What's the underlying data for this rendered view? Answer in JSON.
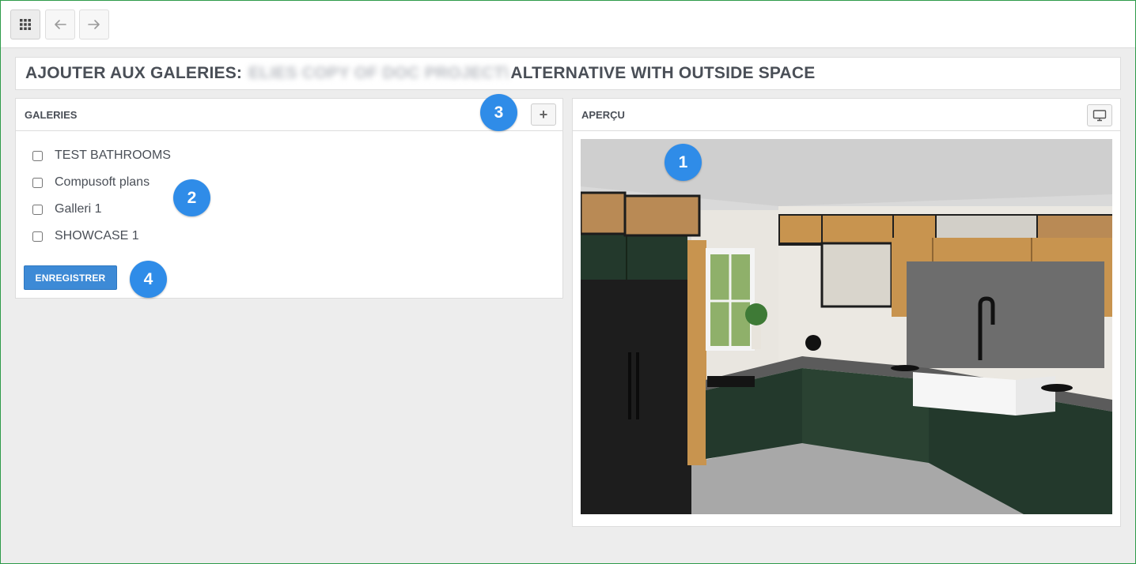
{
  "page": {
    "title_prefix": "AJOUTER AUX GALERIES:",
    "title_blurred": "ELIES COPY OF DOC PROJECT\\",
    "title_suffix": "ALTERNATIVE WITH OUTSIDE SPACE"
  },
  "galleries_panel": {
    "heading": "GALERIES",
    "add_label": "+",
    "items": [
      {
        "label": "TEST BATHROOMS",
        "checked": false
      },
      {
        "label": "Compusoft plans",
        "checked": false
      },
      {
        "label": "Galleri 1",
        "checked": false
      },
      {
        "label": "SHOWCASE 1",
        "checked": false
      }
    ],
    "save_label": "ENREGISTRER"
  },
  "preview_panel": {
    "heading": "APERÇU"
  },
  "badges": [
    "1",
    "2",
    "3",
    "4"
  ],
  "colors": {
    "accent": "#3d8ad6",
    "badge": "#2f8ce8",
    "cabinet_green": "#23392c",
    "wood": "#c8944f"
  },
  "icons": {
    "apps": "grid-icon",
    "back": "arrow-left-icon",
    "forward": "arrow-right-icon",
    "fullscreen": "monitor-icon"
  }
}
